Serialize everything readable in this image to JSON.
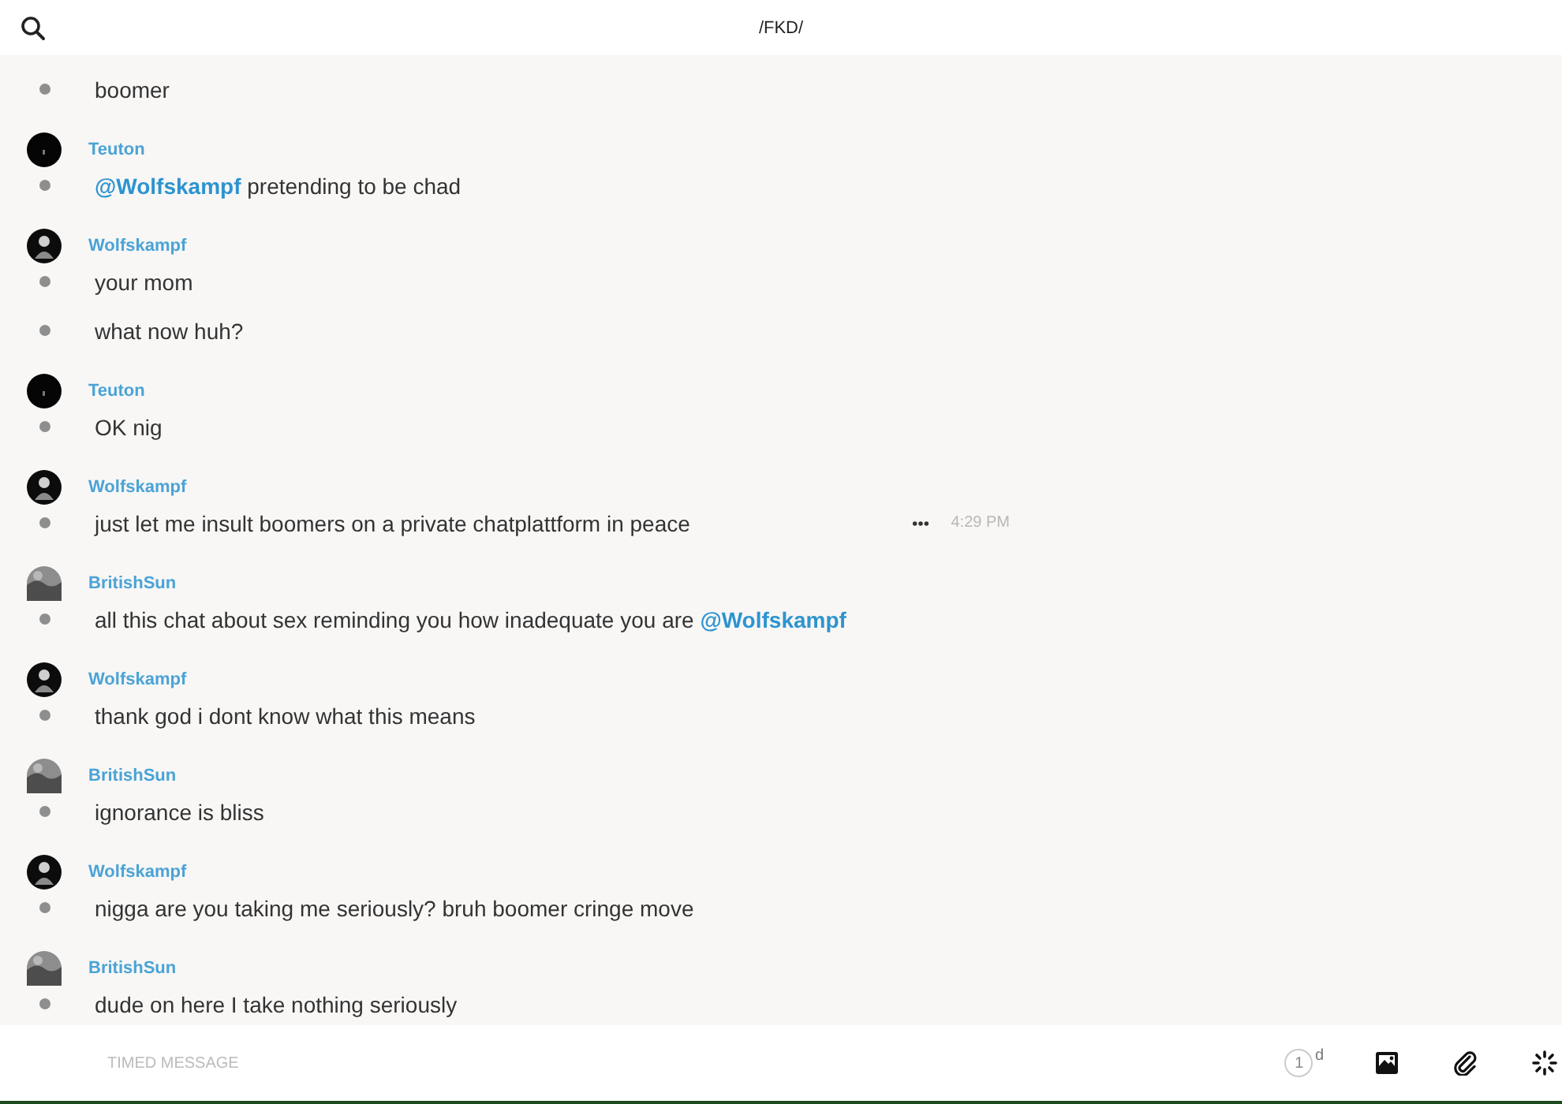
{
  "header": {
    "title": "/FKD/"
  },
  "messages": [
    {
      "lines": [
        {
          "text": "boomer"
        }
      ]
    },
    {
      "author": "Teuton",
      "avatar": {
        "kind": "dark"
      },
      "lines": [
        {
          "text": "**@Wolfskampf** pretending to be chad"
        }
      ]
    },
    {
      "author": "Wolfskampf",
      "avatar": {
        "kind": "figure"
      },
      "lines": [
        {
          "text": "your mom"
        },
        {
          "text": "what now huh?"
        }
      ]
    },
    {
      "author": "Teuton",
      "avatar": {
        "kind": "dark"
      },
      "lines": [
        {
          "text": "OK nig"
        }
      ]
    },
    {
      "author": "Wolfskampf",
      "avatar": {
        "kind": "figure"
      },
      "lines": [
        {
          "text": "just let me insult boomers on a private chatplattform in peace",
          "time": "4:29 PM"
        }
      ]
    },
    {
      "author": "BritishSun",
      "avatar": {
        "kind": "photo"
      },
      "lines": [
        {
          "text": "all this chat about sex reminding you how inadequate you are **@Wolfskampf**"
        }
      ]
    },
    {
      "author": "Wolfskampf",
      "avatar": {
        "kind": "figure"
      },
      "lines": [
        {
          "text": "thank god i dont know what this means"
        }
      ]
    },
    {
      "author": "BritishSun",
      "avatar": {
        "kind": "photo"
      },
      "lines": [
        {
          "text": "ignorance is bliss"
        }
      ]
    },
    {
      "author": "Wolfskampf",
      "avatar": {
        "kind": "figure"
      },
      "lines": [
        {
          "text": "nigga are you taking me seriously? bruh boomer cringe move"
        }
      ]
    },
    {
      "author": "BritishSun",
      "avatar": {
        "kind": "photo"
      },
      "lines": [
        {
          "text": "dude on here I take nothing seriously"
        }
      ]
    }
  ],
  "composer": {
    "placeholder": "TIMED MESSAGE",
    "timer": {
      "value": "1",
      "unit": "d"
    }
  }
}
